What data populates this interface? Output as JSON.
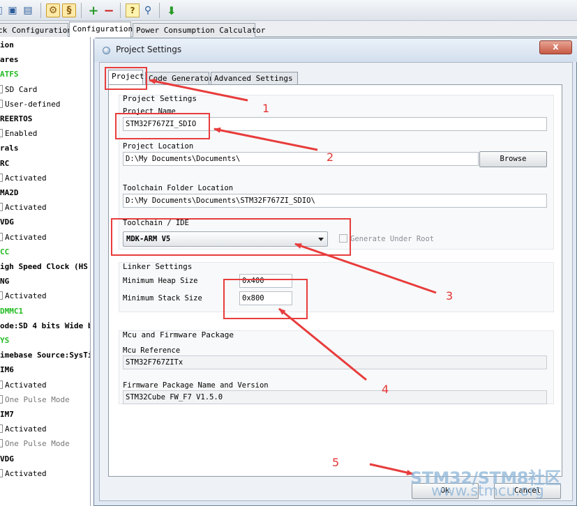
{
  "toolbar": {
    "icons": [
      "open-icon",
      "save-icon",
      "save-as-icon",
      "generate-report-icon",
      "generate-code-icon",
      "add-icon",
      "remove-icon",
      "help-icon",
      "search-icon",
      "download-icon"
    ]
  },
  "main_tabs": [
    {
      "label": "ck Configuration"
    },
    {
      "label": "Configuration",
      "active": true
    },
    {
      "label": "Power Consumption Calculator"
    }
  ],
  "tree": [
    {
      "label": "ion",
      "style": "bold"
    },
    {
      "label": "ares",
      "style": "bold"
    },
    {
      "label": "ATFS",
      "style": "green"
    },
    {
      "label": "SD Card",
      "style": "check"
    },
    {
      "label": "User-defined",
      "style": "check"
    },
    {
      "label": "REERTOS",
      "style": "bold"
    },
    {
      "label": "Enabled",
      "style": "check"
    },
    {
      "label": "rals",
      "style": "bold"
    },
    {
      "label": "RC",
      "style": "bold"
    },
    {
      "label": "Activated",
      "style": "check"
    },
    {
      "label": "MA2D",
      "style": "bold"
    },
    {
      "label": "Activated",
      "style": "check"
    },
    {
      "label": "VDG",
      "style": "bold"
    },
    {
      "label": "Activated",
      "style": "check"
    },
    {
      "label": "CC",
      "style": "green"
    },
    {
      "label": "igh Speed Clock (HS",
      "style": "bold"
    },
    {
      "label": "NG",
      "style": "bold"
    },
    {
      "label": "Activated",
      "style": "check"
    },
    {
      "label": "DMMC1",
      "style": "green"
    },
    {
      "label": "ode:SD 4 bits Wide bu",
      "style": "mode"
    },
    {
      "label": "YS",
      "style": "green"
    },
    {
      "label": "imebase Source:SysTi",
      "style": "mode"
    },
    {
      "label": "IM6",
      "style": "bold"
    },
    {
      "label": "Activated",
      "style": "check"
    },
    {
      "label": "One Pulse Mode",
      "style": "check-gray"
    },
    {
      "label": "IM7",
      "style": "bold"
    },
    {
      "label": "Activated",
      "style": "check"
    },
    {
      "label": "One Pulse Mode",
      "style": "check-gray"
    },
    {
      "label": "VDG",
      "style": "bold"
    },
    {
      "label": "Activated",
      "style": "check"
    }
  ],
  "dialog": {
    "title": "Project Settings",
    "close_label": "x",
    "tabs": [
      {
        "label": "Project",
        "active": true
      },
      {
        "label": "Code Generator"
      },
      {
        "label": "Advanced Settings"
      }
    ],
    "project_settings": {
      "title": "Project Settings",
      "name_label": "Project Name",
      "name_value": "STM32F767ZI_SDIO",
      "location_label": "Project Location",
      "location_value": "D:\\My Documents\\Documents\\",
      "browse_label": "Browse",
      "toolchain_folder_label": "Toolchain Folder Location",
      "toolchain_folder_value": "D:\\My Documents\\Documents\\STM32F767ZI_SDIO\\",
      "toolchain_label": "Toolchain / IDE",
      "toolchain_value": "MDK-ARM V5",
      "generate_under_root_label": "Generate Under Root"
    },
    "linker_settings": {
      "title": "Linker Settings",
      "heap_label": "Minimum Heap Size",
      "heap_value": "0x400",
      "stack_label": "Minimum Stack Size",
      "stack_value": "0x800"
    },
    "mcu_firmware": {
      "title": "Mcu and Firmware Package",
      "mcu_label": "Mcu Reference",
      "mcu_value": "STM32F767ZITx",
      "fw_label": "Firmware Package Name and Version",
      "fw_value": "STM32Cube FW_F7 V1.5.0"
    },
    "ok_label": "Ok",
    "cancel_label": "Cancel"
  },
  "annotations": [
    "1",
    "2",
    "3",
    "4",
    "5"
  ],
  "watermark": {
    "brand": "STM32/STM8社区",
    "url": "www.stmcu.org"
  },
  "colors": {
    "annotation_red": "#e83c3c",
    "tree_green": "#22bb22",
    "dialog_bg": "#dfe8f3",
    "watermark": "#8cb4d7"
  }
}
